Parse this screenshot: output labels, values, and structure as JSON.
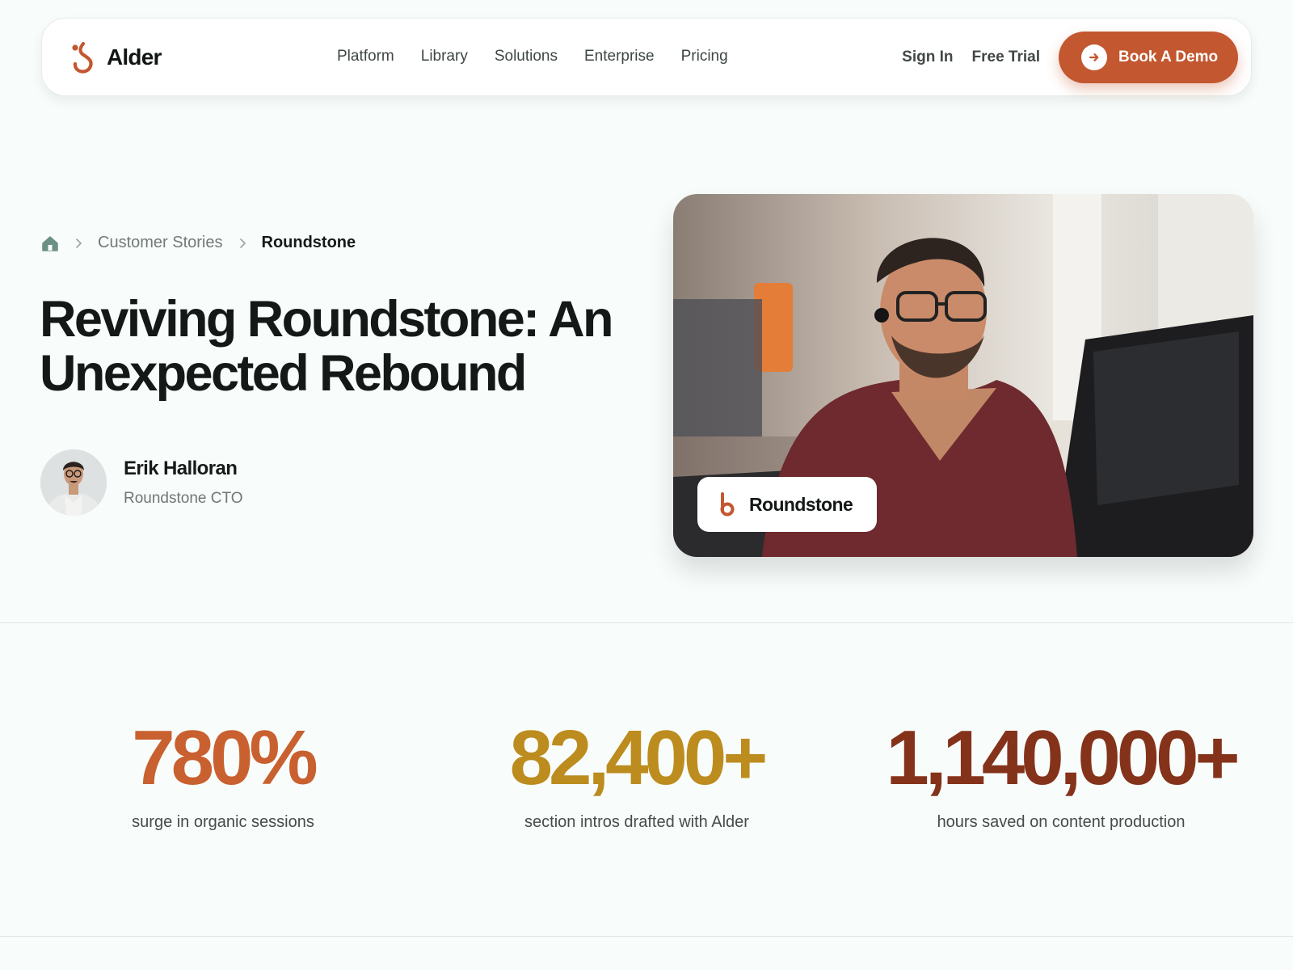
{
  "nav": {
    "brand": "Alder",
    "links": [
      "Platform",
      "Library",
      "Solutions",
      "Enterprise",
      "Pricing"
    ],
    "sign_in": "Sign In",
    "free_trial": "Free Trial",
    "cta": "Book A Demo"
  },
  "breadcrumb": {
    "icon": "home-icon",
    "section": "Customer Stories",
    "current": "Roundstone"
  },
  "hero": {
    "title_line1": "Reviving Roundstone: An",
    "title_line2": "Unexpected Rebound",
    "author_name": "Erik Halloran",
    "author_role": "Roundstone CTO",
    "badge_label": "Roundstone"
  },
  "stats": [
    {
      "value": "780%",
      "label": "surge in organic sessions",
      "color": "#c9602f"
    },
    {
      "value": "82,400+",
      "label": "section intros drafted with Alder",
      "color": "#bd8c1e"
    },
    {
      "value": "1,140,000+",
      "label": "hours saved on content production",
      "color": "#84331a"
    }
  ],
  "colors": {
    "accent": "#c35730",
    "background": "#f8fcfb",
    "text": "#141817"
  }
}
